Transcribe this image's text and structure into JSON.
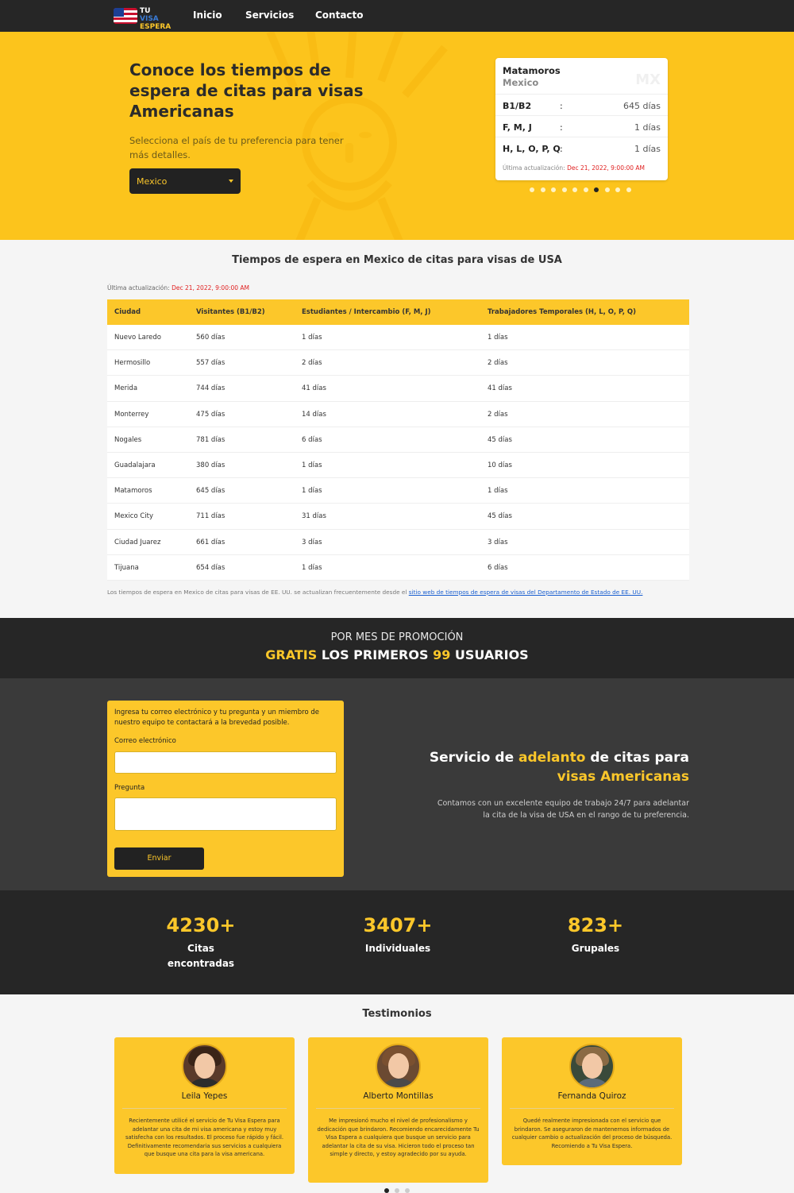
{
  "nav": {
    "logo": {
      "line1": "TU",
      "line1b": "VISA",
      "line2": "ESPERA"
    },
    "links": [
      "Inicio",
      "Servicios",
      "Contacto"
    ]
  },
  "hero": {
    "title": "Conoce los tiempos de espera de citas para visas Americanas",
    "subtitle": "Selecciona el país de tu preferencia para tener más detalles.",
    "select_value": "Mexico",
    "card": {
      "city": "Matamoros",
      "country": "Mexico",
      "code": "MX",
      "rows": [
        {
          "key": "B1/B2",
          "sep": ":",
          "value": "645 días"
        },
        {
          "key": "F, M, J",
          "sep": ":",
          "value": "1 días"
        },
        {
          "key": "H, L, O, P, Q",
          "sep": ":",
          "value": "1 días"
        }
      ],
      "updated_label": "Última actualización:",
      "updated_value": "Dec 21, 2022, 9:00:00 AM"
    },
    "carousel": {
      "count": 10,
      "active": 6
    }
  },
  "table_section": {
    "title": "Tiempos de espera en Mexico de citas para visas de USA",
    "updated_label": "Última actualización:",
    "updated_value": "Dec 21, 2022, 9:00:00 AM",
    "headers": [
      "Ciudad",
      "Visitantes (B1/B2)",
      "Estudiantes / Intercambio (F, M, J)",
      "Trabajadores Temporales (H, L, O, P, Q)"
    ],
    "rows": [
      [
        "Nuevo Laredo",
        "560 días",
        "1 días",
        "1 días"
      ],
      [
        "Hermosillo",
        "557 días",
        "2 días",
        "2 días"
      ],
      [
        "Merida",
        "744 días",
        "41 días",
        "41 días"
      ],
      [
        "Monterrey",
        "475 días",
        "14 días",
        "2 días"
      ],
      [
        "Nogales",
        "781 días",
        "6 días",
        "45 días"
      ],
      [
        "Guadalajara",
        "380 días",
        "1 días",
        "10 días"
      ],
      [
        "Matamoros",
        "645 días",
        "1 días",
        "1 días"
      ],
      [
        "Mexico City",
        "711 días",
        "31 días",
        "45 días"
      ],
      [
        "Ciudad Juarez",
        "661 días",
        "3 días",
        "3 días"
      ],
      [
        "Tijuana",
        "654 días",
        "1 días",
        "6 días"
      ]
    ],
    "footnote": "Los tiempos de espera en Mexico de citas para visas de EE. UU. se actualizan frecuentemente desde el",
    "footnote_link": "sitio web de tiempos de espera de visas del Departamento de Estado de EE. UU."
  },
  "promo": {
    "line1": "POR MES DE PROMOCIÓN",
    "gratis": "GRATIS",
    "mid": "LOS PRIMEROS",
    "num": "99",
    "end": "USUARIOS"
  },
  "contact": {
    "intro": "Ingresa tu correo electrónico y tu pregunta y un miembro de nuestro equipo te contactará a la brevedad posible.",
    "email_label": "Correo electrónico",
    "email_value": "",
    "question_label": "Pregunta",
    "question_value": "",
    "submit": "Enviar",
    "title_a": "Servicio de",
    "title_b": "adelanto",
    "title_c": "de citas para",
    "title_d": "visas Americanas",
    "description": "Contamos con un excelente equipo de trabajo 24/7 para adelantar la cita de la visa de USA en el rango de tu preferencia."
  },
  "stats": [
    {
      "number": "4230+",
      "label": "Citas encontradas"
    },
    {
      "number": "3407+",
      "label": "Individuales"
    },
    {
      "number": "823+",
      "label": "Grupales"
    }
  ],
  "testimonials": {
    "title": "Testimonios",
    "items": [
      {
        "name": "Leila Yepes",
        "text": "Recientemente utilicé el servicio de Tu Visa Espera para adelantar una cita de mi visa americana y estoy muy satisfecha con los resultados. El proceso fue rápido y fácil. Definitivamente recomendaria sus servicios a cualquiera que busque una cita para la visa americana."
      },
      {
        "name": "Alberto Montillas",
        "text": "Me impresionó mucho el nivel de profesionalismo y dedicación que brindaron. Recomiendo encarecidamente Tu Visa Espera a cualquiera que busque un servicio para adelantar la cita de su visa. Hicieron todo el proceso tan simple y directo, y estoy agradecido por su ayuda."
      },
      {
        "name": "Fernanda Quiroz",
        "text": "Quedé realmente impresionada con el servicio que brindaron. Se aseguraron de mantenernos informados de cualquier cambio o actualización del proceso de búsqueda. Recomiendo a Tu Visa Espera."
      }
    ],
    "carousel": {
      "count": 3,
      "active": 0
    }
  },
  "colors": {
    "accent": "#fcc72a",
    "dark": "#262626",
    "link": "#1a5fd0",
    "date": "#e02020"
  }
}
